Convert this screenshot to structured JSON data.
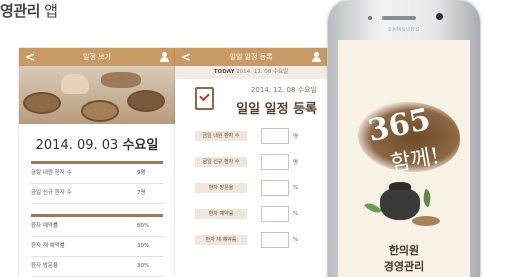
{
  "heading": {
    "bold": "영관리",
    "suffix": " 앱"
  },
  "screen1": {
    "title": "일정 보기",
    "back": "<",
    "date": "2014. 09. 03",
    "day": "수요일",
    "group1": [
      {
        "label": "금일 내원 환자 수",
        "value": "9명"
      },
      {
        "label": "금일 신규 환자 수",
        "value": "7명"
      }
    ],
    "group2": [
      {
        "label": "환자 예약률",
        "value": "80%"
      },
      {
        "label": "환자 재 예약률",
        "value": "30%"
      },
      {
        "label": "환자 방문율",
        "value": "30%"
      }
    ]
  },
  "screen2": {
    "title": "일일 일정 등록",
    "back": "<",
    "today_label": "TODAY",
    "today_value": "2014. 12. 08 수요일",
    "reg_date": "2014. 12. 08 수요일",
    "reg_title": "일일 일정 등록",
    "fields": [
      {
        "label": "금일 내원 환자 수",
        "unit": "명"
      },
      {
        "label": "금일 신규 환자 수",
        "unit": "명"
      },
      {
        "label": "환자 방문율",
        "unit": "%"
      },
      {
        "label": "환자 예약률",
        "unit": "%"
      },
      {
        "label": "환자 재 예약률",
        "unit": "%"
      }
    ]
  },
  "phone": {
    "brand_label": "SAMSUNG",
    "splash_number": "365",
    "splash_text": "함께!",
    "name_line1": "한의원",
    "name_line2": "경영관리"
  },
  "colors": {
    "brown_bar": "#c99a63",
    "accent": "#9c7a55"
  }
}
